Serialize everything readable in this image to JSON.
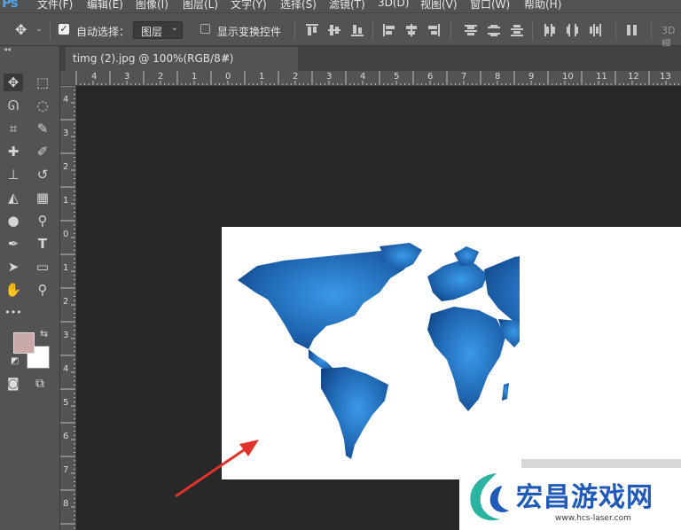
{
  "app": {
    "logo": "Ps"
  },
  "menu": {
    "items": [
      "文件(F)",
      "编辑(E)",
      "图像(I)",
      "图层(L)",
      "文字(Y)",
      "选择(S)",
      "滤镜(T)",
      "3D(D)",
      "视图(V)",
      "窗口(W)",
      "帮助(H)"
    ]
  },
  "options": {
    "auto_select_label": "自动选择：",
    "auto_select_checked": true,
    "layer_select_value": "图层",
    "transform_label": "显示变换控件",
    "transform_checked": false,
    "mode_3d_label": "3D 模"
  },
  "tabs": [
    {
      "title": "timg (2).jpg @ 100%(RGB/8#)",
      "close_glyph": "×",
      "active": true
    }
  ],
  "rulers": {
    "top_labels": [
      "4",
      "3",
      "2",
      "1",
      "0",
      "1",
      "2",
      "3",
      "4",
      "5",
      "6",
      "7",
      "8",
      "9",
      "10",
      "11",
      "12",
      "13"
    ],
    "left_labels": [
      "4",
      "3",
      "2",
      "1",
      "0",
      "1",
      "2",
      "3",
      "4",
      "5",
      "6",
      "7",
      "8"
    ]
  },
  "tools": [
    {
      "name": "move-tool",
      "glyph": "✥",
      "active": true
    },
    {
      "name": "marquee-tool",
      "glyph": "⬚"
    },
    {
      "name": "lasso-tool",
      "glyph": "ᘏ"
    },
    {
      "name": "quick-select-tool",
      "glyph": "◌"
    },
    {
      "name": "crop-tool",
      "glyph": "⌗"
    },
    {
      "name": "eyedropper-tool",
      "glyph": "✎"
    },
    {
      "name": "healing-brush-tool",
      "glyph": "✚"
    },
    {
      "name": "brush-tool",
      "glyph": "✐"
    },
    {
      "name": "stamp-tool",
      "glyph": "⊥"
    },
    {
      "name": "history-brush-tool",
      "glyph": "↺"
    },
    {
      "name": "eraser-tool",
      "glyph": "◭"
    },
    {
      "name": "gradient-tool",
      "glyph": "▦"
    },
    {
      "name": "blur-tool",
      "glyph": "●"
    },
    {
      "name": "dodge-tool",
      "glyph": "⚲"
    },
    {
      "name": "pen-tool",
      "glyph": "✒"
    },
    {
      "name": "type-tool",
      "glyph": "T"
    },
    {
      "name": "path-select-tool",
      "glyph": "➤"
    },
    {
      "name": "shape-tool",
      "glyph": "▭"
    },
    {
      "name": "hand-tool",
      "glyph": "✋"
    },
    {
      "name": "zoom-tool",
      "glyph": "⚲"
    },
    {
      "name": "more-tools",
      "glyph": "•••"
    }
  ],
  "colors": {
    "foreground": "#c9a8a8",
    "background": "#ffffff",
    "map_blue": "#1e66b0",
    "arrow": "#e0332b"
  },
  "watermark": {
    "title": "宏昌游戏网",
    "url": "www.hcs-laser.com"
  }
}
